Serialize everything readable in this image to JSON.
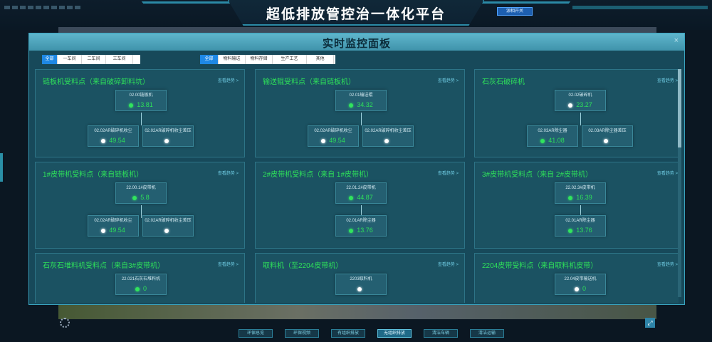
{
  "app": {
    "title": "超低排放管控治一体化平台",
    "top_button": "源相开关"
  },
  "modal": {
    "title": "实时监控面板",
    "close_label": "×",
    "workshop_filters": [
      {
        "label": "全部",
        "active": true
      },
      {
        "label": "一车间",
        "active": false
      },
      {
        "label": "二车间",
        "active": false
      },
      {
        "label": "三车间",
        "active": false
      }
    ],
    "category_filters": [
      {
        "label": "全部",
        "active": true
      },
      {
        "label": "物料输送",
        "active": false
      },
      {
        "label": "物料存储",
        "active": false
      },
      {
        "label": "生产工艺",
        "active": false
      },
      {
        "label": "其他",
        "active": false
      }
    ],
    "trend_label": "查看趋势 >",
    "cards": [
      {
        "title": "链板机受料点（来自破碎卸料坑）",
        "main": {
          "label": "02.00链板机",
          "value": "13.81",
          "status": "on"
        },
        "subs": [
          {
            "label": "02.02AR破碎机收尘",
            "value": "49.54",
            "status": "off"
          },
          {
            "label": "02.02AR破碎机收尘差压",
            "value": "",
            "status": "off"
          }
        ]
      },
      {
        "title": "输送辊受料点（来自链板机）",
        "main": {
          "label": "02.01输送辊",
          "value": "34.32",
          "status": "on"
        },
        "subs": [
          {
            "label": "02.02AR破碎机收尘",
            "value": "49.54",
            "status": "off"
          },
          {
            "label": "02.02AR破碎机收尘差压",
            "value": "",
            "status": "off"
          }
        ]
      },
      {
        "title": "石灰石破碎机",
        "main": {
          "label": "02.02破碎机",
          "value": "23.27",
          "status": "off"
        },
        "subs": [
          {
            "label": "02.03AR除尘器",
            "value": "41.08",
            "status": "on"
          },
          {
            "label": "02.03AR除尘器差压",
            "value": "",
            "status": "off"
          }
        ]
      },
      {
        "title": "1#皮带机受料点（来自链板机）",
        "main": {
          "label": "22.00.1#皮带机",
          "value": "5.8",
          "status": "on"
        },
        "subs": [
          {
            "label": "02.02AR破碎机收尘",
            "value": "49.54",
            "status": "off"
          },
          {
            "label": "02.02AR破碎机收尘差压",
            "value": "",
            "status": "off"
          }
        ]
      },
      {
        "title": "2#皮带机受料点（来自 1#皮带机）",
        "main": {
          "label": "22.01.2#皮带机",
          "value": "44.87",
          "status": "on"
        },
        "subs": [
          {
            "label": "02.01AR除尘器",
            "value": "13.76",
            "status": "on"
          }
        ]
      },
      {
        "title": "3#皮带机受料点（来自 2#皮带机）",
        "main": {
          "label": "22.02.3#皮带机",
          "value": "16.39",
          "status": "on"
        },
        "subs": [
          {
            "label": "02.01AR除尘器",
            "value": "13.76",
            "status": "on"
          }
        ]
      },
      {
        "title": "石灰石堆料机受料点（来自3#皮带机）",
        "main": {
          "label": "22.021石灰石堆料机",
          "value": "0",
          "status": "on"
        },
        "subs": []
      },
      {
        "title": "取料机（至2204皮带机）",
        "main": {
          "label": "2203取料机",
          "value": "",
          "status": "off"
        },
        "subs": []
      },
      {
        "title": "2204皮带受料点（来自取料机皮带）",
        "main": {
          "label": "22.04皮带输送机",
          "value": "0",
          "status": "off"
        },
        "subs": []
      }
    ]
  },
  "bottom_nav": [
    {
      "label": "环保总览",
      "active": false
    },
    {
      "label": "环保视频",
      "active": false
    },
    {
      "label": "有组织排放",
      "active": false
    },
    {
      "label": "无组织排放",
      "active": true
    },
    {
      "label": "清洁车辆",
      "active": false
    },
    {
      "label": "清洁运输",
      "active": false
    }
  ],
  "corner_right_icon": "expand-icon",
  "colors": {
    "value_green": "#2ee05a",
    "title_green": "#2ee05a",
    "panel": "#1b5262",
    "header": "#5fb6cc",
    "active_blue": "#1e88e5"
  }
}
